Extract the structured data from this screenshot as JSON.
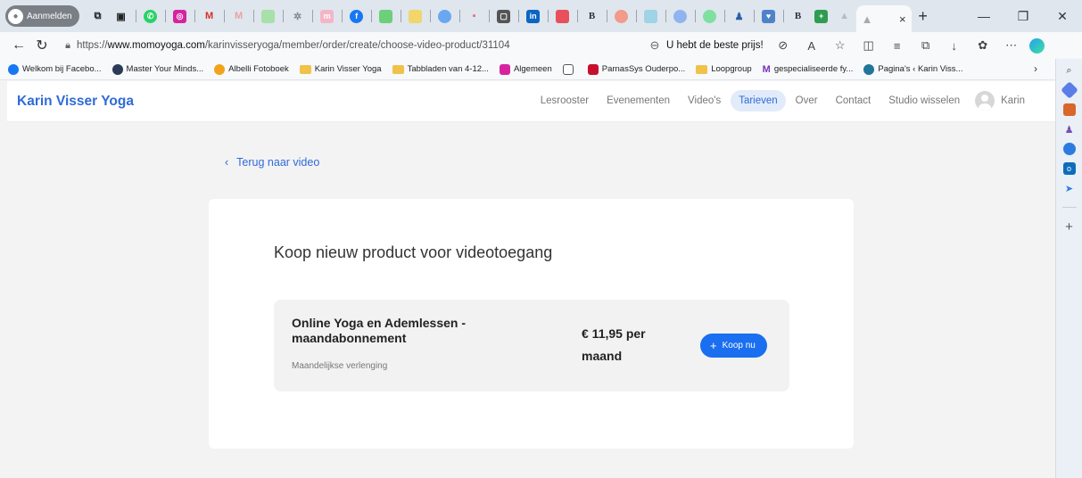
{
  "browser": {
    "profile_label": "Aanmelden",
    "url_prefix": "https://",
    "url_host": "www.momoyoga.com",
    "url_path": "/karinvisseryoga/member/order/create/choose-video-product/31104",
    "promo_text": "U hebt de beste prijs!",
    "tab_close": "×",
    "new_tab": "+"
  },
  "bookmarks": [
    {
      "label": "Welkom bij Facebo...",
      "icon_color": "#1877f2"
    },
    {
      "label": "Master Your Minds...",
      "icon_color": "#2b3a55"
    },
    {
      "label": "Albelli Fotoboek",
      "icon_color": "#f2a31b"
    },
    {
      "label": "Karin Visser Yoga",
      "icon_color": "#f0c24a"
    },
    {
      "label": "Tabbladen van 4-12...",
      "icon_color": "#f0c24a"
    },
    {
      "label": "Algemeen",
      "icon_color": "#d6249f"
    },
    {
      "label": "",
      "icon_color": "#555555"
    },
    {
      "label": "ParnasSys Ouderpo...",
      "icon_color": "#c8102e"
    },
    {
      "label": "Loopgroup",
      "icon_color": "#f0c24a"
    },
    {
      "label": "gespecialiseerde fy...",
      "icon_color": "#7b2fbf"
    },
    {
      "label": "Pagina's ‹ Karin Viss...",
      "icon_color": "#21759b"
    }
  ],
  "site": {
    "brand": "Karin Visser Yoga",
    "nav": [
      "Lesrooster",
      "Evenementen",
      "Video's",
      "Tarieven",
      "Over",
      "Contact",
      "Studio wisselen"
    ],
    "active_nav": "Tarieven",
    "user_name": "Karin"
  },
  "main": {
    "back_label": "Terug naar video",
    "title": "Koop nieuw product voor videotoegang",
    "product": {
      "name": "Online Yoga en Ademlessen - maandabonnement",
      "renewal": "Maandelijkse verlenging",
      "price": "€ 11,95 per maand",
      "buy_label": "Koop nu"
    }
  },
  "colors": {
    "accent": "#2f6bd8",
    "button": "#1a6ff0"
  }
}
